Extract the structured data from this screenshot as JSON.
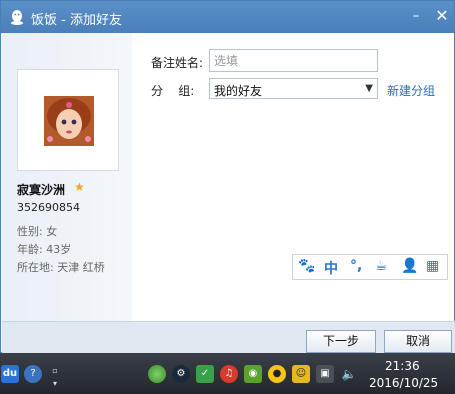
{
  "window": {
    "title": "饭饭 - 添加好友",
    "minimize_label": "–",
    "close_label": "✕"
  },
  "profile": {
    "nickname": "寂寞沙洲",
    "qq_number": "352690854",
    "gender": "性别: 女",
    "age": "年龄: 43岁",
    "location": "所在地: 天津  红桥"
  },
  "form": {
    "name_label": "备注姓名:",
    "name_placeholder": "选填",
    "name_value": "",
    "group_label": "分    组:",
    "group_value": "我的好友",
    "new_group_link": "新建分组"
  },
  "ime_bar": {
    "items": [
      "🐾",
      "中",
      "°,",
      "☕",
      "👤",
      "▦"
    ]
  },
  "buttons": {
    "next": "下一步",
    "cancel": "取消"
  },
  "taskbar": {
    "du_label": "du",
    "help_label": "?",
    "time": "21:36",
    "date": "2016/10/25"
  },
  "colors": {
    "titlebar": "#4a7fb9",
    "link": "#2d6db5",
    "star": "#f3a622"
  }
}
